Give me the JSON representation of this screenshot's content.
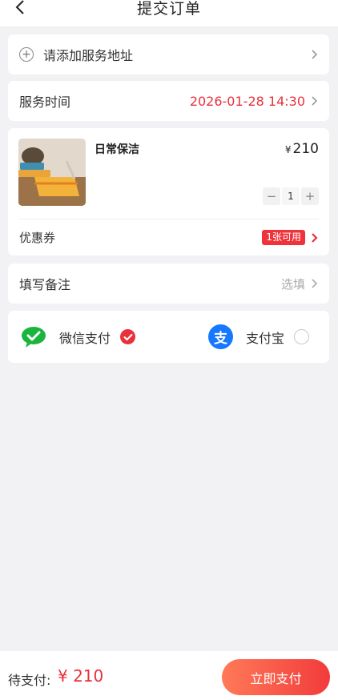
{
  "header": {
    "title": "提交订单"
  },
  "address": {
    "label": "请添加服务地址"
  },
  "service_time": {
    "label": "服务时间",
    "value": "2026-01-28 14:30"
  },
  "product": {
    "name": "日常保洁",
    "price_symbol": "¥",
    "price": "210",
    "quantity": "1",
    "minus": "−",
    "plus": "+"
  },
  "coupon": {
    "label": "优惠券",
    "badge": "1张可用"
  },
  "note": {
    "label": "填写备注",
    "placeholder": "选填"
  },
  "payment": {
    "wechat_label": "微信支付",
    "alipay_label": "支付宝",
    "alipay_icon_char": "支",
    "selected": "wechat"
  },
  "footer": {
    "label": "待支付:",
    "amount": "¥ 210",
    "submit_label": "立即支付"
  },
  "colors": {
    "accent": "#e8313b",
    "wechat": "#19b53c",
    "alipay": "#1677ff"
  }
}
